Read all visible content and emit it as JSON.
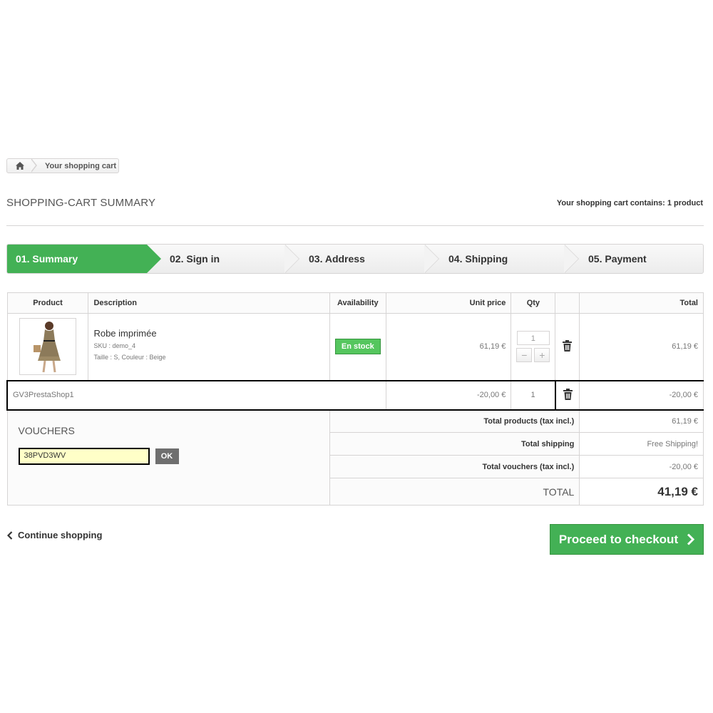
{
  "breadcrumb": {
    "home_icon": "home-icon",
    "current": "Your shopping cart"
  },
  "heading": {
    "title": "SHOPPING-CART SUMMARY",
    "count_text": "Your shopping cart contains: 1 product"
  },
  "steps": [
    "01. Summary",
    "02. Sign in",
    "03. Address",
    "04. Shipping",
    "05. Payment"
  ],
  "table": {
    "headers": {
      "product": "Product",
      "description": "Description",
      "availability": "Availability",
      "unit_price": "Unit price",
      "qty": "Qty",
      "total": "Total"
    },
    "item": {
      "name": "Robe imprimée",
      "sku": "SKU : demo_4",
      "attributes": "Taille : S, Couleur : Beige",
      "availability": "En stock",
      "unit_price": "61,19 €",
      "qty": "1",
      "total": "61,19 €"
    },
    "voucher_line": {
      "code": "GV3PrestaShop1",
      "unit_price": "-20,00 €",
      "qty": "1",
      "total": "-20,00 €"
    }
  },
  "vouchers": {
    "title": "VOUCHERS",
    "input_value": "38PVD3WV",
    "ok_label": "OK"
  },
  "totals": {
    "products_label": "Total products (tax incl.)",
    "products_value": "61,19 €",
    "shipping_label": "Total shipping",
    "shipping_value": "Free Shipping!",
    "vouchers_label": "Total vouchers (tax incl.)",
    "vouchers_value": "-20,00 €",
    "total_label": "TOTAL",
    "total_value": "41,19 €"
  },
  "actions": {
    "continue_label": "Continue shopping",
    "checkout_label": "Proceed to checkout"
  },
  "colors": {
    "accent_green": "#43b155",
    "stock_green": "#55c65e",
    "voucher_input_bg": "#ffffc8"
  }
}
